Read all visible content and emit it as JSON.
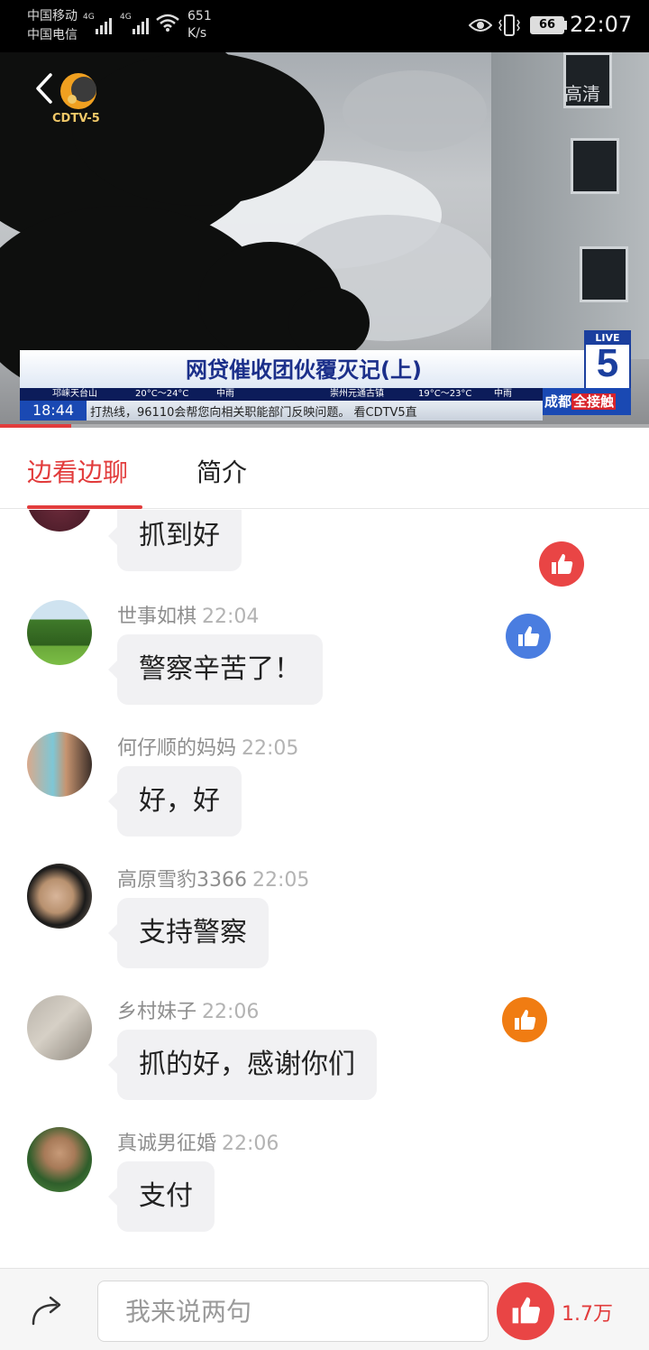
{
  "status_bar": {
    "carrier_1": "中国移动",
    "carrier_2": "中国电信",
    "net_1": "4G",
    "net_2": "4G",
    "speed": "651",
    "speed_unit": "K/s",
    "battery": "66",
    "time": "22:07"
  },
  "video": {
    "channel_logo": "CDTV-5",
    "quality": "高清",
    "news_title": "网贷催收团伙覆灭记(上)",
    "live_badge": "LIVE",
    "live_number": "5",
    "weather": [
      "邛崃天台山",
      "20°C～24°C",
      "中雨",
      "崇州元通古镇",
      "19°C～23°C",
      "中雨"
    ],
    "ticker_time": "18:44",
    "ticker_text": "打热线，96110会帮您向相关职能部门反映问题。    看CDTV5直",
    "brand_left": "成都",
    "brand_right": "全接触",
    "progress": 0.11
  },
  "tabs": [
    {
      "label": "边看边聊",
      "active": true
    },
    {
      "label": "简介",
      "active": false
    }
  ],
  "messages": [
    {
      "user": "",
      "time": "",
      "text": "抓到好"
    },
    {
      "user": "世事如棋",
      "time": "22:04",
      "text": "警察辛苦了！"
    },
    {
      "user": "何仔顺的妈妈",
      "time": "22:05",
      "text": "好，好"
    },
    {
      "user": "高原雪豹3366",
      "time": "22:05",
      "text": "支持警察"
    },
    {
      "user": "乡村妹子",
      "time": "22:06",
      "text": "抓的好，感谢你们"
    },
    {
      "user": "真诚男征婚",
      "time": "22:06",
      "text": "支付"
    }
  ],
  "floating_likes": [
    {
      "color": "#e94545"
    },
    {
      "color": "#4a7de0"
    },
    {
      "color": "#f07c12"
    }
  ],
  "bottom_bar": {
    "placeholder": "我来说两句",
    "like_count": "1.7万"
  },
  "colors": {
    "accent": "#e23c3c",
    "bubble": "#f1f1f3"
  }
}
